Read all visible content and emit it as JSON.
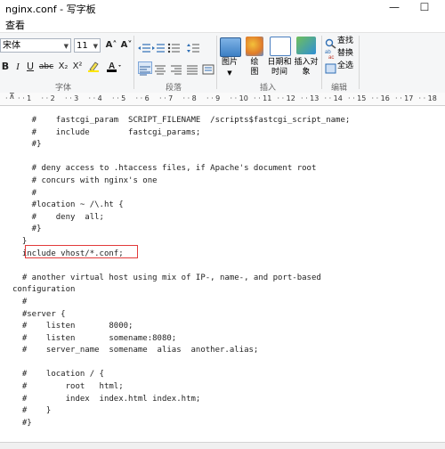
{
  "window": {
    "title": "nginx.conf - 写字板",
    "minimize_glyph": "—",
    "maximize_glyph": "☐"
  },
  "menu": {
    "view_label": "查看"
  },
  "ribbon": {
    "font_name": "宋体",
    "font_size": "11",
    "grow_font": "A˄",
    "shrink_font": "A˅",
    "bold": "B",
    "italic": "I",
    "underline": "U",
    "strikethrough": "abc",
    "subscript": "X₂",
    "superscript": "X²",
    "groups": {
      "font": "字体",
      "paragraph": "段落",
      "insert": "插入",
      "edit": "编辑"
    },
    "insert": {
      "picture": "图片",
      "paint": "绘图",
      "datetime": "日期和时间",
      "object": "插入对象"
    },
    "edit": {
      "find": "查找",
      "replace": "替换",
      "select_all": "全选"
    }
  },
  "ruler_ticks": [
    "1",
    "2",
    "3",
    "4",
    "5",
    "6",
    "7",
    "8",
    "9",
    "10",
    "11",
    "12",
    "13",
    "14",
    "15",
    "16",
    "17",
    "18"
  ],
  "document": {
    "text": "    #    fastcgi_param  SCRIPT_FILENAME  /scripts$fastcgi_script_name;\n    #    include        fastcgi_params;\n    #}\n\n    # deny access to .htaccess files, if Apache's document root\n    # concurs with nginx's one\n    #\n    #location ~ /\\.ht {\n    #    deny  all;\n    #}\n  }\n  include vhost/*.conf;\n\n  # another virtual host using mix of IP-, name-, and port-based\nconfiguration\n  #\n  #server {\n  #    listen       8000;\n  #    listen       somename:8080;\n  #    server_name  somename  alias  another.alias;\n\n  #    location / {\n  #        root   html;\n  #        index  index.html index.htm;\n  #    }\n  #}"
  }
}
